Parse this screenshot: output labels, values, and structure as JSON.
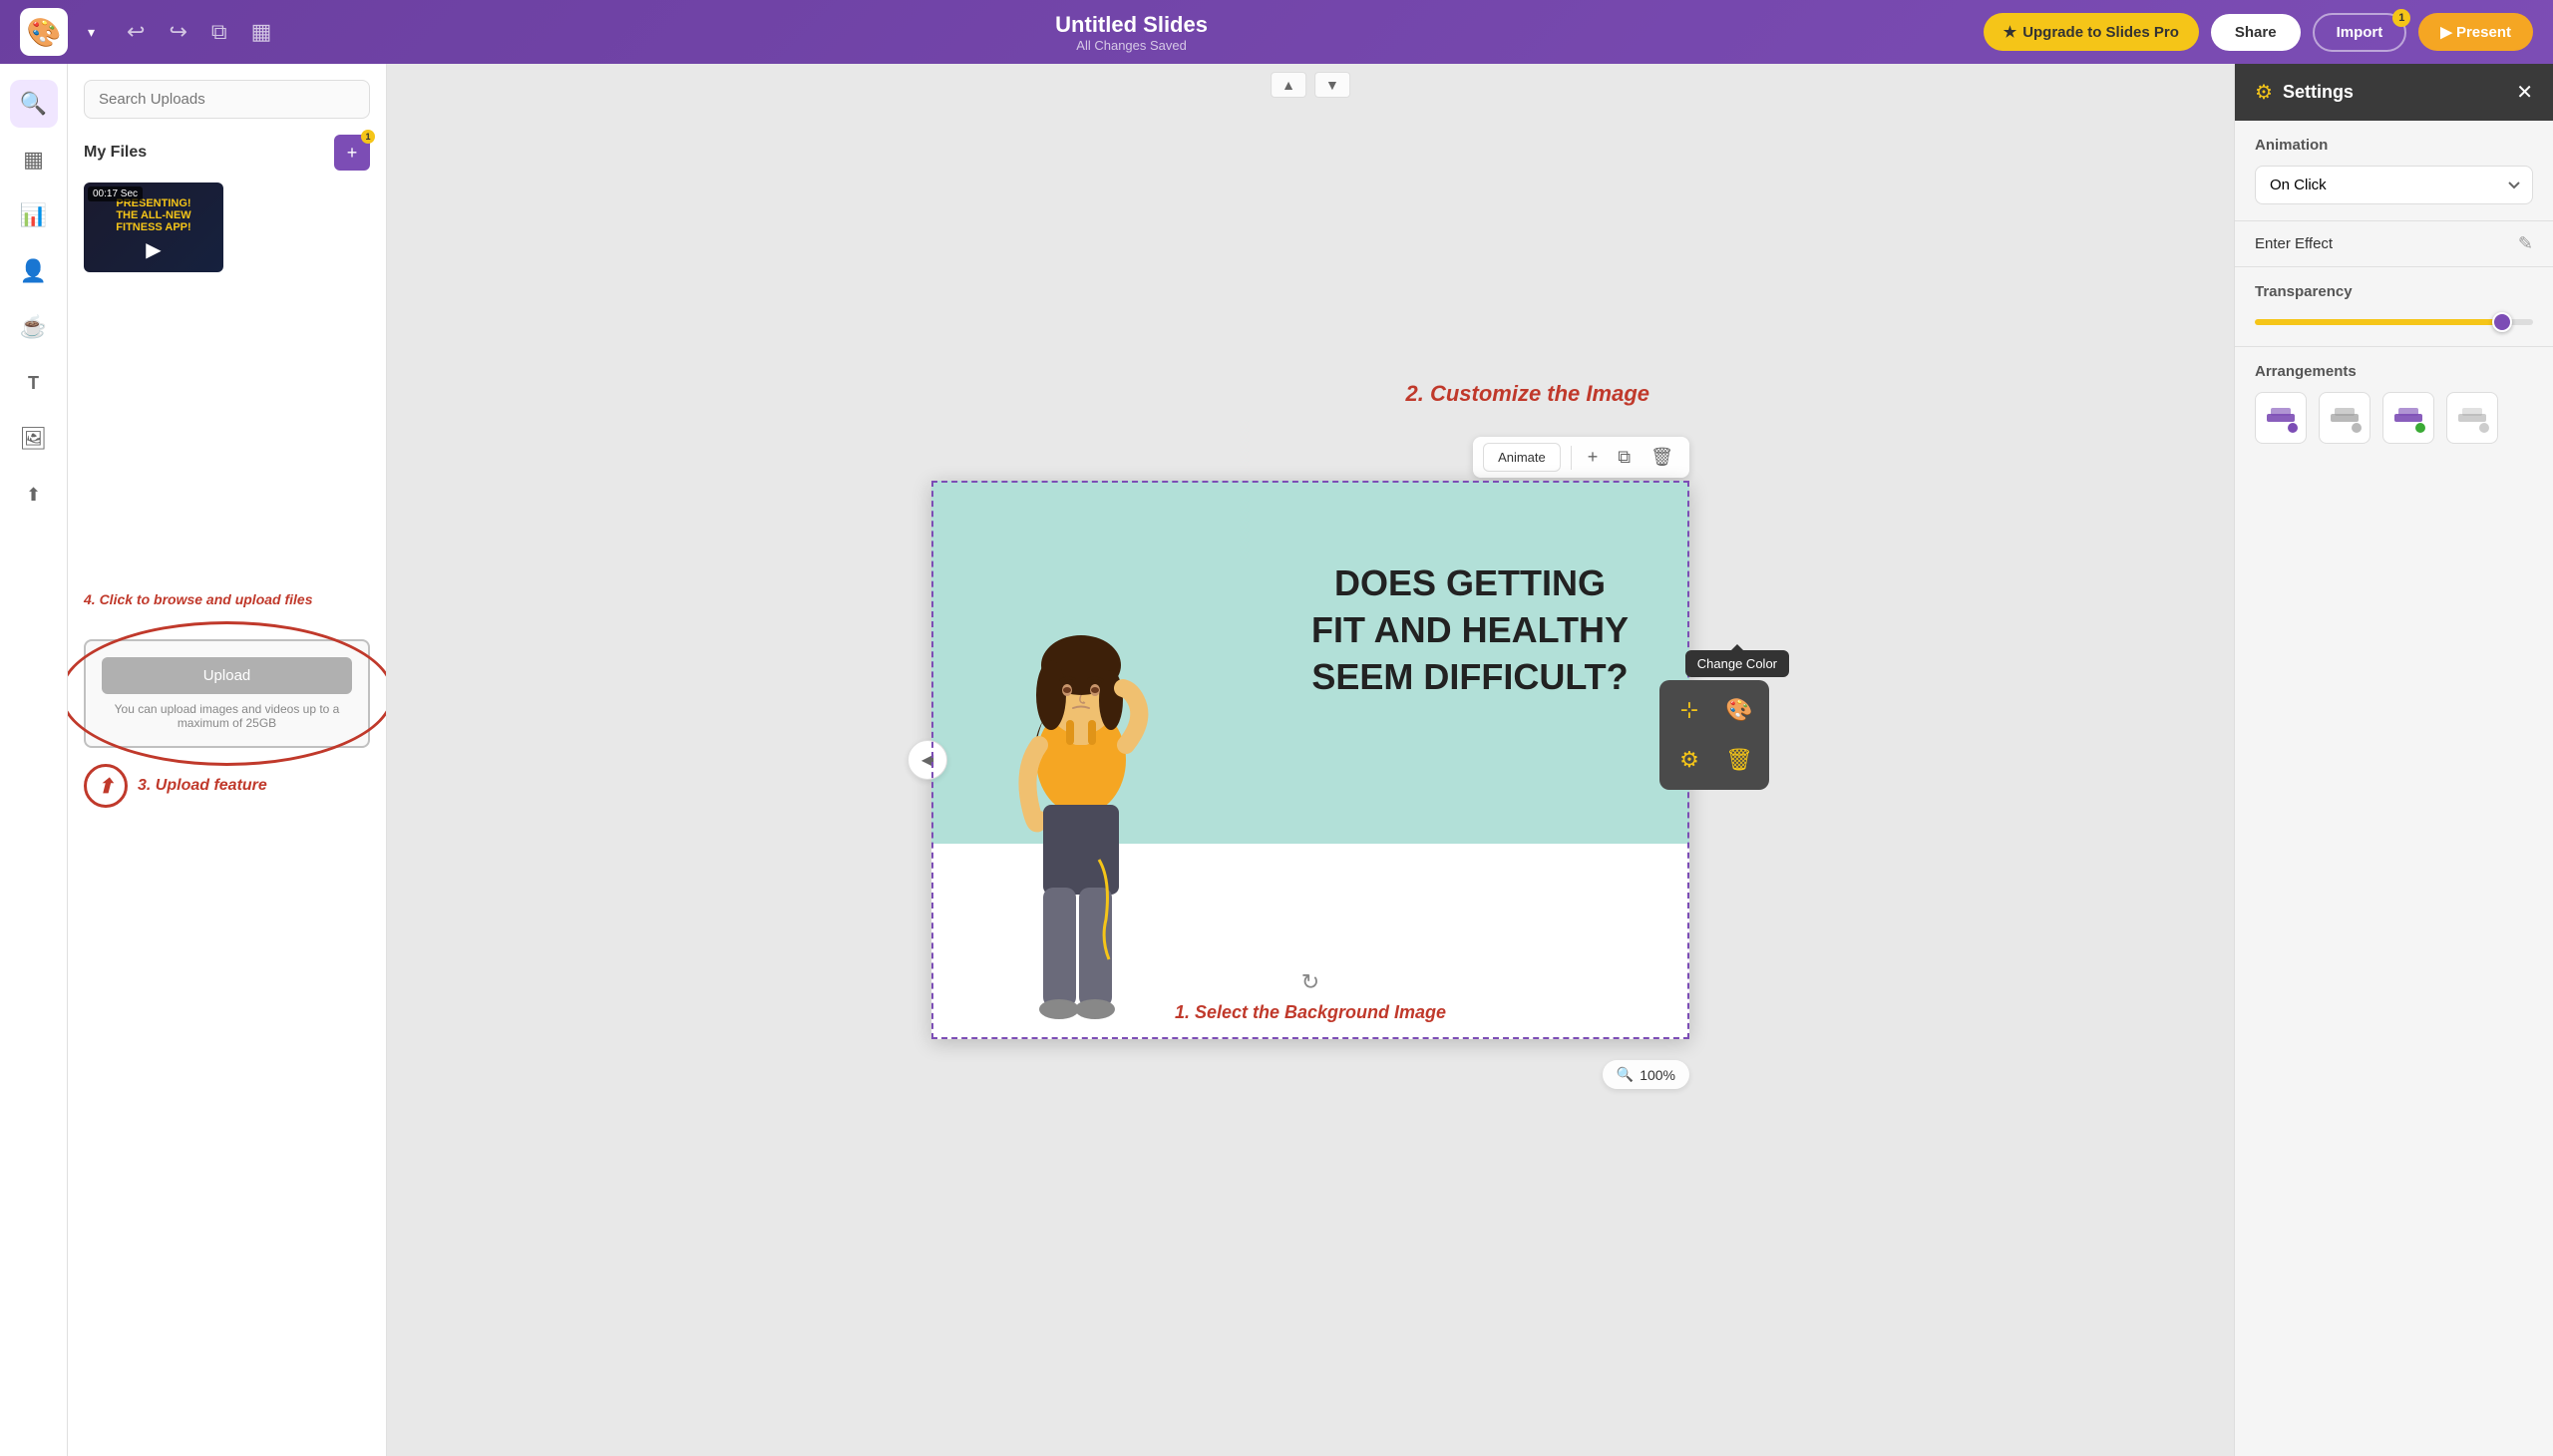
{
  "app": {
    "name": "Untitled Slides",
    "subtitle": "All Changes Saved"
  },
  "topbar": {
    "logo_emoji": "🎨",
    "undo_label": "↩",
    "redo_label": "↪",
    "duplicate_label": "⧉",
    "grid_label": "⊞",
    "upgrade_label": "Upgrade to Slides Pro",
    "share_label": "Share",
    "import_label": "Import",
    "import_badge": "1",
    "present_label": "▶ Present"
  },
  "left_sidebar": {
    "icons": [
      {
        "name": "search-icon",
        "symbol": "🔍"
      },
      {
        "name": "layout-icon",
        "symbol": "▦"
      },
      {
        "name": "chart-icon",
        "symbol": "📊"
      },
      {
        "name": "people-icon",
        "symbol": "👤"
      },
      {
        "name": "coffee-icon",
        "symbol": "☕"
      },
      {
        "name": "text-icon",
        "symbol": "T"
      },
      {
        "name": "image-icon",
        "symbol": "🖼"
      },
      {
        "name": "upload-icon",
        "symbol": "⬆"
      }
    ]
  },
  "upload_panel": {
    "search_placeholder": "Search Uploads",
    "my_files_label": "My Files",
    "video_duration": "00:17 Sec",
    "video_label": "PRESENTING! THE ALL-NEW FITNESS APP!",
    "annotation_upload": "4. Click to browse and upload files",
    "upload_btn_label": "Upload",
    "upload_desc": "You can upload images and videos up to a maximum of 25GB",
    "upload_feature_label": "3. Upload feature"
  },
  "settings": {
    "title": "Settings",
    "close_icon": "✕",
    "animation_label": "Animation",
    "animation_value": "On Click",
    "enter_effect_label": "Enter Effect",
    "transparency_label": "Transparency",
    "transparency_value": 92,
    "arrangements_label": "Arrangements"
  },
  "slide": {
    "text_line1": "DOES GETTING",
    "text_line2": "FIT AND HEALTHY",
    "text_line3": "SEEM DIFFICULT?",
    "annotation_customize": "2. Customize the Image",
    "annotation_bg": "1. Select the Background Image",
    "zoom": "100%"
  },
  "toolbar": {
    "animate_label": "Animate",
    "change_color_tooltip": "Change Color"
  },
  "element_menu": [
    {
      "icon": "⊹",
      "type": "move",
      "color": "gold"
    },
    {
      "icon": "🎨",
      "type": "color",
      "color": "gold"
    },
    {
      "icon": "⚙",
      "type": "settings",
      "color": "gold"
    },
    {
      "icon": "🗑",
      "type": "delete",
      "color": "gold"
    }
  ]
}
